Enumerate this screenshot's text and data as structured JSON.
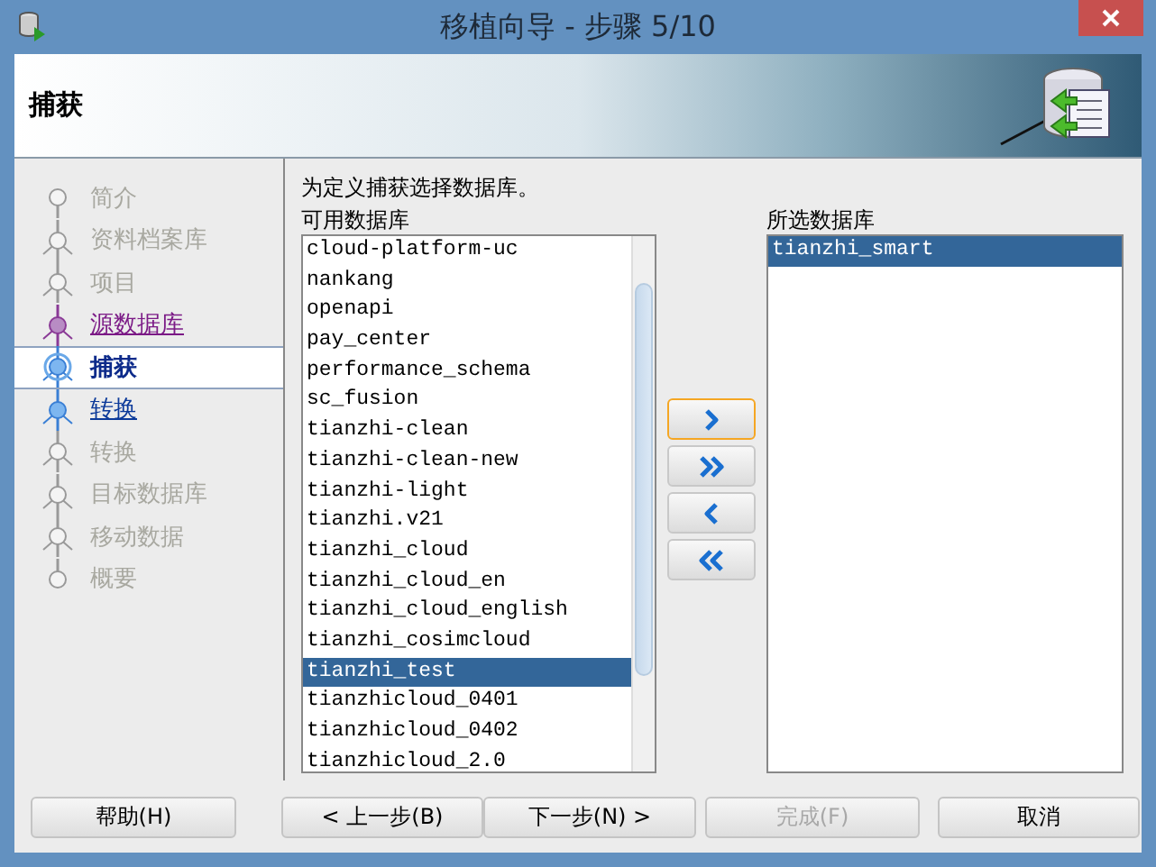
{
  "window": {
    "title": "移植向导 - 步骤 5/10"
  },
  "header": {
    "title": "捕获"
  },
  "steps": [
    {
      "label": "简介",
      "kind": "disabled",
      "selected": false
    },
    {
      "label": "资料档案库",
      "kind": "disabled",
      "selected": false
    },
    {
      "label": "项目",
      "kind": "disabled",
      "selected": false
    },
    {
      "label": "源数据库",
      "kind": "visited",
      "selected": false
    },
    {
      "label": "捕获",
      "kind": "link",
      "selected": true
    },
    {
      "label": "转换",
      "kind": "link",
      "selected": false
    },
    {
      "label": "转换",
      "kind": "disabled",
      "selected": false
    },
    {
      "label": "目标数据库",
      "kind": "disabled",
      "selected": false
    },
    {
      "label": "移动数据",
      "kind": "disabled",
      "selected": false
    },
    {
      "label": "概要",
      "kind": "disabled",
      "selected": false
    }
  ],
  "instruction": "为定义捕获选择数据库。",
  "available": {
    "label": "可用数据库",
    "items": [
      {
        "name": "cloud-platform-uc",
        "selected": false
      },
      {
        "name": "nankang",
        "selected": false
      },
      {
        "name": "openapi",
        "selected": false
      },
      {
        "name": "pay_center",
        "selected": false
      },
      {
        "name": "performance_schema",
        "selected": false
      },
      {
        "name": "sc_fusion",
        "selected": false
      },
      {
        "name": "tianzhi-clean",
        "selected": false
      },
      {
        "name": "tianzhi-clean-new",
        "selected": false
      },
      {
        "name": "tianzhi-light",
        "selected": false
      },
      {
        "name": "tianzhi.v21",
        "selected": false
      },
      {
        "name": "tianzhi_cloud",
        "selected": false
      },
      {
        "name": "tianzhi_cloud_en",
        "selected": false
      },
      {
        "name": "tianzhi_cloud_english",
        "selected": false
      },
      {
        "name": "tianzhi_cosimcloud",
        "selected": false
      },
      {
        "name": "tianzhi_test",
        "selected": true
      },
      {
        "name": "tianzhicloud_0401",
        "selected": false
      },
      {
        "name": "tianzhicloud_0402",
        "selected": false
      },
      {
        "name": "tianzhicloud_2.0",
        "selected": false
      }
    ]
  },
  "move_buttons": [
    {
      "kind": "add",
      "focused": true
    },
    {
      "kind": "add_all",
      "focused": false
    },
    {
      "kind": "remove",
      "focused": false
    },
    {
      "kind": "remove_all",
      "focused": false
    }
  ],
  "selected_list": {
    "label": "所选数据库",
    "items": [
      {
        "name": "tianzhi_smart",
        "selected": true
      }
    ]
  },
  "buttons": [
    {
      "label": "帮助(H)",
      "disabled": false,
      "kind": "help"
    },
    {
      "label": "< 上一步(B)",
      "disabled": false,
      "kind": "back"
    },
    {
      "label": "下一步(N) >",
      "disabled": false,
      "kind": "next"
    },
    {
      "label": "完成(F)",
      "disabled": true,
      "kind": "finish"
    },
    {
      "label": "取消",
      "disabled": false,
      "kind": "cancel"
    }
  ]
}
